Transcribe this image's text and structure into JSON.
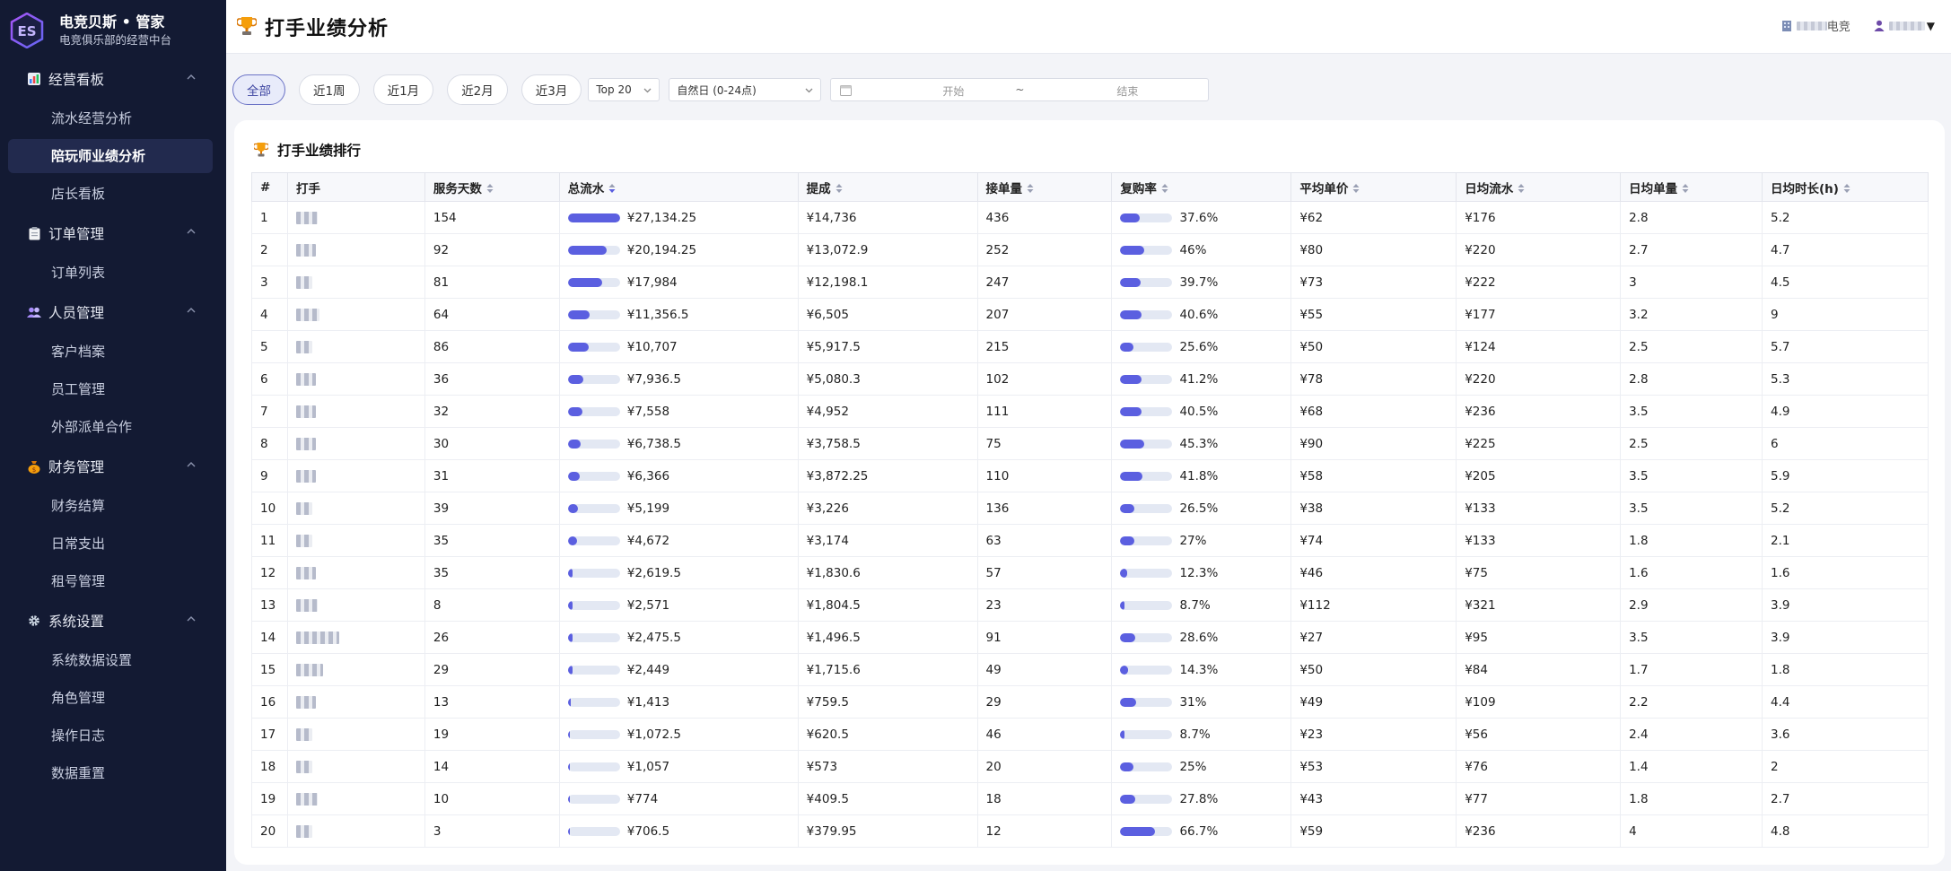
{
  "brand": {
    "title": "电竞贝斯 • 管家",
    "subtitle": "电竞俱乐部的经营中台",
    "logo_text": "ES"
  },
  "sidebar": {
    "groups": [
      {
        "label": "经营看板",
        "icon": "chart-icon",
        "items": [
          "流水经营分析",
          "陪玩师业绩分析",
          "店长看板"
        ]
      },
      {
        "label": "订单管理",
        "icon": "clipboard-icon",
        "items": [
          "订单列表"
        ]
      },
      {
        "label": "人员管理",
        "icon": "users-icon",
        "items": [
          "客户档案",
          "员工管理",
          "外部派单合作"
        ]
      },
      {
        "label": "财务管理",
        "icon": "money-bag-icon",
        "items": [
          "财务结算",
          "日常支出",
          "租号管理"
        ]
      },
      {
        "label": "系统设置",
        "icon": "gear-icon",
        "items": [
          "系统数据设置",
          "角色管理",
          "操作日志",
          "数据重置"
        ]
      }
    ],
    "active_item": "陪玩师业绩分析"
  },
  "header": {
    "title": "打手业绩分析",
    "club_suffix": "电竞",
    "user_caret": "▼"
  },
  "filters": {
    "ranges": [
      "全部",
      "近1周",
      "近1月",
      "近2月",
      "近3月"
    ],
    "active_range": "全部",
    "top_select": "Top 20",
    "day_select": "自然日 (0-24点)",
    "date_start_placeholder": "开始",
    "date_separator": "~",
    "date_end_placeholder": "结束"
  },
  "card": {
    "title": "打手业绩排行"
  },
  "table": {
    "columns": [
      "#",
      "打手",
      "服务天数",
      "总流水",
      "提成",
      "接单量",
      "复购率",
      "平均单价",
      "日均流水",
      "日均单量",
      "日均时长(h)"
    ],
    "sortable": [
      false,
      false,
      true,
      true,
      true,
      true,
      true,
      true,
      true,
      true,
      true
    ],
    "active_sort": "总流水",
    "rows": [
      {
        "rank": "1",
        "days": "154",
        "revenue": "¥27,134.25",
        "revenue_pct": 1.0,
        "commission": "¥14,736",
        "orders": "436",
        "repurchase": "37.6%",
        "repurchase_pct": 0.376,
        "avg_price": "¥62",
        "daily_revenue": "¥176",
        "daily_orders": "2.8",
        "daily_hours": "5.2"
      },
      {
        "rank": "2",
        "days": "92",
        "revenue": "¥20,194.25",
        "revenue_pct": 0.744,
        "commission": "¥13,072.9",
        "orders": "252",
        "repurchase": "46%",
        "repurchase_pct": 0.46,
        "avg_price": "¥80",
        "daily_revenue": "¥220",
        "daily_orders": "2.7",
        "daily_hours": "4.7"
      },
      {
        "rank": "3",
        "days": "81",
        "revenue": "¥17,984",
        "revenue_pct": 0.663,
        "commission": "¥12,198.1",
        "orders": "247",
        "repurchase": "39.7%",
        "repurchase_pct": 0.397,
        "avg_price": "¥73",
        "daily_revenue": "¥222",
        "daily_orders": "3",
        "daily_hours": "4.5"
      },
      {
        "rank": "4",
        "days": "64",
        "revenue": "¥11,356.5",
        "revenue_pct": 0.419,
        "commission": "¥6,505",
        "orders": "207",
        "repurchase": "40.6%",
        "repurchase_pct": 0.406,
        "avg_price": "¥55",
        "daily_revenue": "¥177",
        "daily_orders": "3.2",
        "daily_hours": "9"
      },
      {
        "rank": "5",
        "days": "86",
        "revenue": "¥10,707",
        "revenue_pct": 0.395,
        "commission": "¥5,917.5",
        "orders": "215",
        "repurchase": "25.6%",
        "repurchase_pct": 0.256,
        "avg_price": "¥50",
        "daily_revenue": "¥124",
        "daily_orders": "2.5",
        "daily_hours": "5.7"
      },
      {
        "rank": "6",
        "days": "36",
        "revenue": "¥7,936.5",
        "revenue_pct": 0.292,
        "commission": "¥5,080.3",
        "orders": "102",
        "repurchase": "41.2%",
        "repurchase_pct": 0.412,
        "avg_price": "¥78",
        "daily_revenue": "¥220",
        "daily_orders": "2.8",
        "daily_hours": "5.3"
      },
      {
        "rank": "7",
        "days": "32",
        "revenue": "¥7,558",
        "revenue_pct": 0.279,
        "commission": "¥4,952",
        "orders": "111",
        "repurchase": "40.5%",
        "repurchase_pct": 0.405,
        "avg_price": "¥68",
        "daily_revenue": "¥236",
        "daily_orders": "3.5",
        "daily_hours": "4.9"
      },
      {
        "rank": "8",
        "days": "30",
        "revenue": "¥6,738.5",
        "revenue_pct": 0.248,
        "commission": "¥3,758.5",
        "orders": "75",
        "repurchase": "45.3%",
        "repurchase_pct": 0.453,
        "avg_price": "¥90",
        "daily_revenue": "¥225",
        "daily_orders": "2.5",
        "daily_hours": "6"
      },
      {
        "rank": "9",
        "days": "31",
        "revenue": "¥6,366",
        "revenue_pct": 0.235,
        "commission": "¥3,872.25",
        "orders": "110",
        "repurchase": "41.8%",
        "repurchase_pct": 0.418,
        "avg_price": "¥58",
        "daily_revenue": "¥205",
        "daily_orders": "3.5",
        "daily_hours": "5.9"
      },
      {
        "rank": "10",
        "days": "39",
        "revenue": "¥5,199",
        "revenue_pct": 0.192,
        "commission": "¥3,226",
        "orders": "136",
        "repurchase": "26.5%",
        "repurchase_pct": 0.265,
        "avg_price": "¥38",
        "daily_revenue": "¥133",
        "daily_orders": "3.5",
        "daily_hours": "5.2"
      },
      {
        "rank": "11",
        "days": "35",
        "revenue": "¥4,672",
        "revenue_pct": 0.172,
        "commission": "¥3,174",
        "orders": "63",
        "repurchase": "27%",
        "repurchase_pct": 0.27,
        "avg_price": "¥74",
        "daily_revenue": "¥133",
        "daily_orders": "1.8",
        "daily_hours": "2.1"
      },
      {
        "rank": "12",
        "days": "35",
        "revenue": "¥2,619.5",
        "revenue_pct": 0.097,
        "commission": "¥1,830.6",
        "orders": "57",
        "repurchase": "12.3%",
        "repurchase_pct": 0.123,
        "avg_price": "¥46",
        "daily_revenue": "¥75",
        "daily_orders": "1.6",
        "daily_hours": "1.6"
      },
      {
        "rank": "13",
        "days": "8",
        "revenue": "¥2,571",
        "revenue_pct": 0.095,
        "commission": "¥1,804.5",
        "orders": "23",
        "repurchase": "8.7%",
        "repurchase_pct": 0.087,
        "avg_price": "¥112",
        "daily_revenue": "¥321",
        "daily_orders": "2.9",
        "daily_hours": "3.9"
      },
      {
        "rank": "14",
        "days": "26",
        "revenue": "¥2,475.5",
        "revenue_pct": 0.091,
        "commission": "¥1,496.5",
        "orders": "91",
        "repurchase": "28.6%",
        "repurchase_pct": 0.286,
        "avg_price": "¥27",
        "daily_revenue": "¥95",
        "daily_orders": "3.5",
        "daily_hours": "3.9"
      },
      {
        "rank": "15",
        "days": "29",
        "revenue": "¥2,449",
        "revenue_pct": 0.09,
        "commission": "¥1,715.6",
        "orders": "49",
        "repurchase": "14.3%",
        "repurchase_pct": 0.143,
        "avg_price": "¥50",
        "daily_revenue": "¥84",
        "daily_orders": "1.7",
        "daily_hours": "1.8"
      },
      {
        "rank": "16",
        "days": "13",
        "revenue": "¥1,413",
        "revenue_pct": 0.052,
        "commission": "¥759.5",
        "orders": "29",
        "repurchase": "31%",
        "repurchase_pct": 0.31,
        "avg_price": "¥49",
        "daily_revenue": "¥109",
        "daily_orders": "2.2",
        "daily_hours": "4.4"
      },
      {
        "rank": "17",
        "days": "19",
        "revenue": "¥1,072.5",
        "revenue_pct": 0.04,
        "commission": "¥620.5",
        "orders": "46",
        "repurchase": "8.7%",
        "repurchase_pct": 0.087,
        "avg_price": "¥23",
        "daily_revenue": "¥56",
        "daily_orders": "2.4",
        "daily_hours": "3.6"
      },
      {
        "rank": "18",
        "days": "14",
        "revenue": "¥1,057",
        "revenue_pct": 0.039,
        "commission": "¥573",
        "orders": "20",
        "repurchase": "25%",
        "repurchase_pct": 0.25,
        "avg_price": "¥53",
        "daily_revenue": "¥76",
        "daily_orders": "1.4",
        "daily_hours": "2"
      },
      {
        "rank": "19",
        "days": "10",
        "revenue": "¥774",
        "revenue_pct": 0.029,
        "commission": "¥409.5",
        "orders": "18",
        "repurchase": "27.8%",
        "repurchase_pct": 0.278,
        "avg_price": "¥43",
        "daily_revenue": "¥77",
        "daily_orders": "1.8",
        "daily_hours": "2.7"
      },
      {
        "rank": "20",
        "days": "3",
        "revenue": "¥706.5",
        "revenue_pct": 0.026,
        "commission": "¥379.95",
        "orders": "12",
        "repurchase": "66.7%",
        "repurchase_pct": 0.667,
        "avg_price": "¥59",
        "daily_revenue": "¥236",
        "daily_orders": "4",
        "daily_hours": "4.8"
      }
    ]
  },
  "colors": {
    "sidebar_bg": "#131a33",
    "sidebar_active_bg": "#222a4e",
    "accent": "#5b5fe0",
    "bar_track": "#e3e8f3"
  }
}
